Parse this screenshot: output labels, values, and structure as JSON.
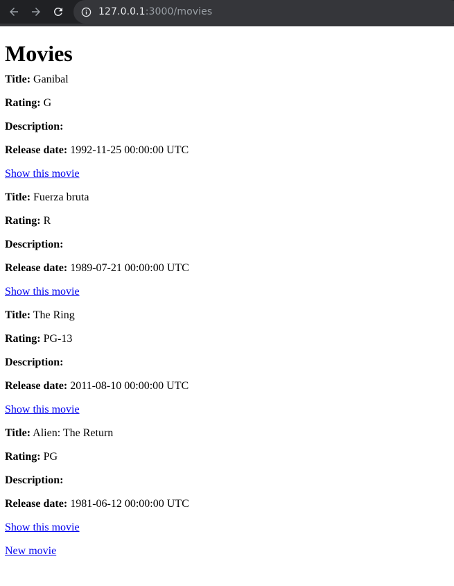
{
  "browser": {
    "url_host": "127.0.0.1",
    "url_path": ":3000/movies"
  },
  "page": {
    "title": "Movies",
    "labels": {
      "title": "Title:",
      "rating": "Rating:",
      "description": "Description:",
      "release_date": "Release date:"
    },
    "show_link_label": "Show this movie",
    "new_movie_label": "New movie"
  },
  "movies": [
    {
      "title": "Ganibal",
      "rating": "G",
      "description": "",
      "release_date": "1992-11-25 00:00:00 UTC"
    },
    {
      "title": "Fuerza bruta",
      "rating": "R",
      "description": "",
      "release_date": "1989-07-21 00:00:00 UTC"
    },
    {
      "title": "The Ring",
      "rating": "PG-13",
      "description": "",
      "release_date": "2011-08-10 00:00:00 UTC"
    },
    {
      "title": "Alien: The Return",
      "rating": "PG",
      "description": "",
      "release_date": "1981-06-12 00:00:00 UTC"
    }
  ],
  "colors": {
    "link": "#0000ee",
    "browser_bar": "#202124",
    "omnibox": "#35363a"
  }
}
